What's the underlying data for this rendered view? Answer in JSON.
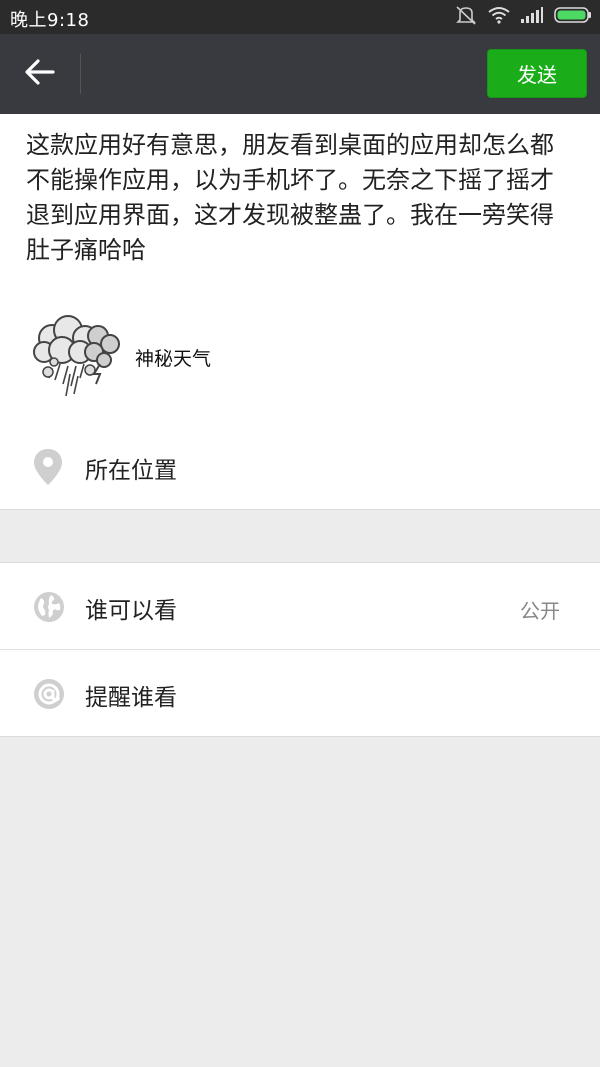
{
  "status_bar": {
    "time": "晚上9:18",
    "icons": [
      "mute-icon",
      "wifi-icon",
      "signal-icon",
      "battery-icon"
    ]
  },
  "nav": {
    "back_icon": "back-arrow-icon",
    "send_label": "发送"
  },
  "compose": {
    "text": "这款应用好有意思，朋友看到桌面的应用却怎么都不能操作应用，以为手机坏了。无奈之下摇了摇才退到应用界面，这才发现被整蛊了。我在一旁笑得肚子痛哈哈",
    "attachment": {
      "icon": "storm-cloud-icon",
      "title": "神秘天气"
    },
    "location": {
      "icon": "location-pin-icon",
      "label": "所在位置"
    }
  },
  "settings": [
    {
      "icon": "globe-icon",
      "label": "谁可以看",
      "value": "公开"
    },
    {
      "icon": "at-icon",
      "label": "提醒谁看",
      "value": ""
    }
  ],
  "colors": {
    "navbar": "#393a3f",
    "statusbar": "#2b2b2b",
    "send_button": "#1aad19",
    "background": "#ececec"
  }
}
